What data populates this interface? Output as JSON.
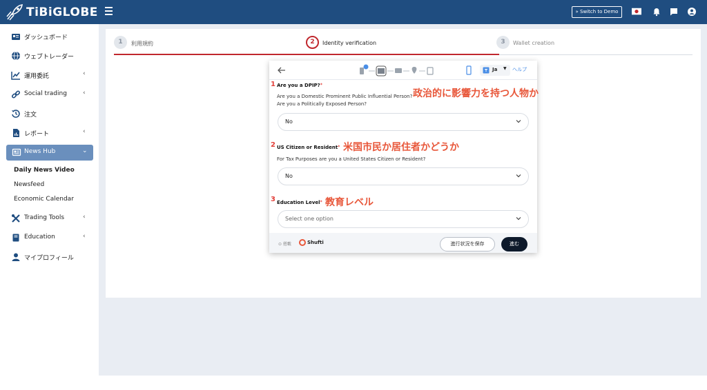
{
  "header": {
    "logo_text": "TiBiGLOBE",
    "switch_demo_label": "» Switch to Demo"
  },
  "sidebar": {
    "items": [
      {
        "label": "ダッシュボード"
      },
      {
        "label": "ウェブトレーダー"
      },
      {
        "label": "運用委託"
      },
      {
        "label": "Social trading"
      },
      {
        "label": "注文"
      },
      {
        "label": "レポート"
      },
      {
        "label": "News Hub"
      },
      {
        "label": "Trading Tools"
      },
      {
        "label": "Education"
      },
      {
        "label": "マイプロフィール"
      }
    ],
    "news_hub_sub": [
      "Daily News Video",
      "Newsfeed",
      "Economic Calendar"
    ]
  },
  "stepper": {
    "steps": [
      {
        "num": "1",
        "label": "利用規約"
      },
      {
        "num": "2",
        "label": "Identity verification"
      },
      {
        "num": "3",
        "label": "Wallet creation"
      }
    ],
    "active_color": "#c0272d"
  },
  "modal": {
    "lang": "Ja",
    "help": "ヘルプ",
    "q1": {
      "num": "1",
      "label": "Are you a DPIP?",
      "line1": "Are you a Domestic Prominent Public Influential Person?",
      "line2": "Are you a Politically Exposed Person?",
      "value": "No",
      "annotation": "政治的に影響力を持つ人物か"
    },
    "q2": {
      "num": "2",
      "label": "US Citizen or Resident",
      "line1": "For Tax Purposes are you a United States Citizen or Resident?",
      "value": "No",
      "annotation": "米国市民か居住者かどうか"
    },
    "q3": {
      "num": "3",
      "label": "Education Level",
      "placeholder": "Select one option",
      "annotation": "教育レベル"
    },
    "powered_by": "⊙ 搭載",
    "brand": "Shufti",
    "save_label": "進行状況を保存",
    "next_label": "進む"
  }
}
